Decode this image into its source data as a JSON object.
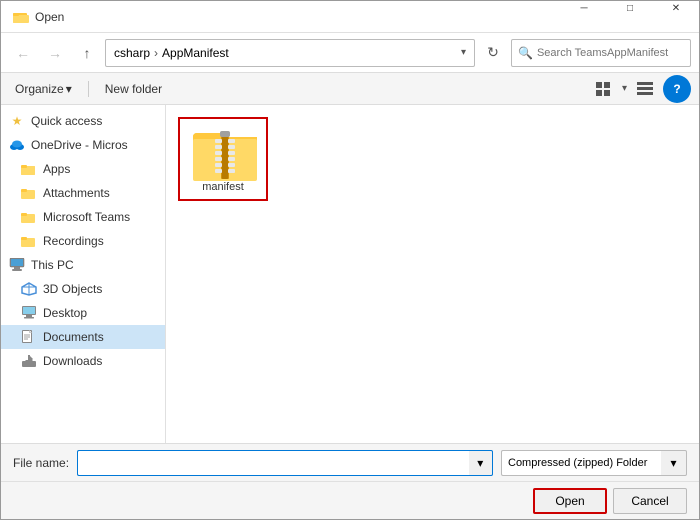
{
  "window": {
    "title": "Open",
    "title_icon": "📂"
  },
  "nav": {
    "back_label": "←",
    "forward_label": "→",
    "up_label": "↑",
    "breadcrumb": {
      "root": "csharp",
      "separator": "›",
      "current": "AppManifest"
    },
    "refresh_label": "⟳",
    "search_placeholder": "Search TeamsAppManifest"
  },
  "toolbar": {
    "organize_label": "Organize",
    "organize_arrow": "▾",
    "new_folder_label": "New folder",
    "view_icon": "⊞",
    "view2_icon": "☰",
    "help_label": "?"
  },
  "sidebar": {
    "quick_access_label": "Quick access",
    "quick_access_icon": "★",
    "onedrive_label": "OneDrive - Micros",
    "items": [
      {
        "id": "apps",
        "label": "Apps",
        "icon": "folder"
      },
      {
        "id": "attachments",
        "label": "Attachments",
        "icon": "folder"
      },
      {
        "id": "microsoft-teams",
        "label": "Microsoft Teams",
        "icon": "folder"
      },
      {
        "id": "recordings",
        "label": "Recordings",
        "icon": "folder"
      }
    ],
    "thispc_label": "This PC",
    "pc_items": [
      {
        "id": "3d-objects",
        "label": "3D Objects",
        "icon": "3d"
      },
      {
        "id": "desktop",
        "label": "Desktop",
        "icon": "desktop"
      },
      {
        "id": "documents",
        "label": "Documents",
        "icon": "docs",
        "active": true
      },
      {
        "id": "downloads",
        "label": "Downloads",
        "icon": "downloads"
      }
    ]
  },
  "main": {
    "file_item": {
      "label": "manifest",
      "type": "zip"
    }
  },
  "bottom": {
    "file_name_label": "File name:",
    "file_name_value": "",
    "file_type_label": "Compressed (zipped) Folder",
    "open_label": "Open",
    "cancel_label": "Cancel"
  }
}
